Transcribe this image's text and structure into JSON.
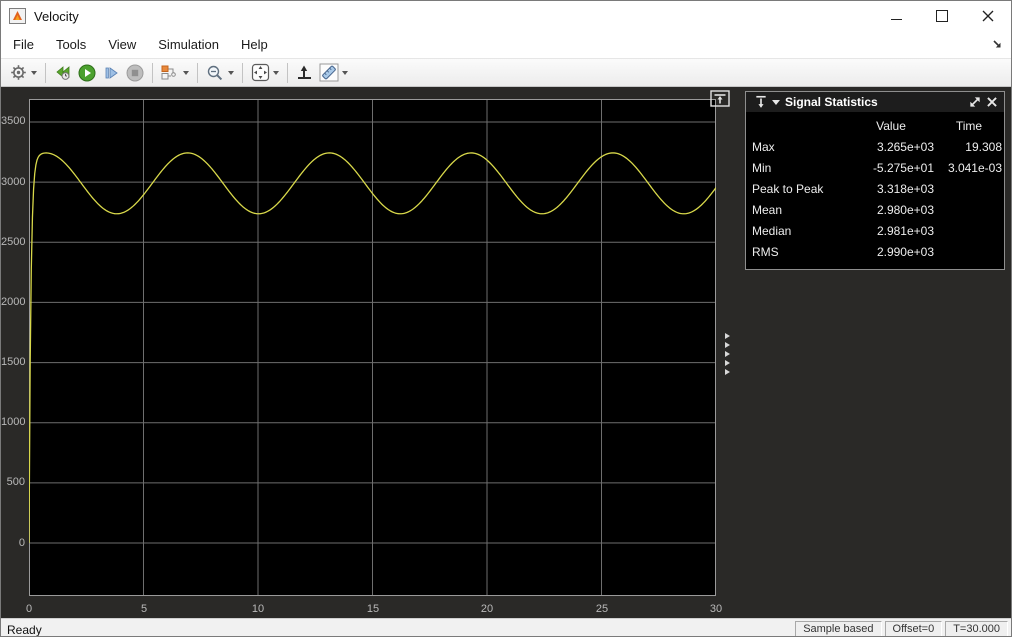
{
  "window": {
    "title": "Velocity"
  },
  "menu": {
    "items": [
      "File",
      "Tools",
      "View",
      "Simulation",
      "Help"
    ]
  },
  "toolbar": {
    "buttons": [
      {
        "name": "settings-gear-button",
        "dropdown": true
      },
      {
        "name": "step-back-button"
      },
      {
        "name": "run-button"
      },
      {
        "name": "step-forward-button"
      },
      {
        "name": "stop-button"
      },
      {
        "name": "signal-selector-button",
        "dropdown": true
      },
      {
        "name": "zoom-out-button",
        "dropdown": true
      },
      {
        "name": "fit-to-view-button",
        "dropdown": true
      },
      {
        "name": "trigger-button"
      },
      {
        "name": "measurements-button",
        "dropdown": true
      }
    ]
  },
  "stats_panel": {
    "title": "Signal Statistics",
    "columns": [
      "Value",
      "Time"
    ],
    "rows": [
      {
        "label": "Max",
        "value": "3.265e+03",
        "time": "19.308"
      },
      {
        "label": "Min",
        "value": "-5.275e+01",
        "time": "3.041e-03"
      },
      {
        "label": "Peak to Peak",
        "value": "3.318e+03",
        "time": ""
      },
      {
        "label": "Mean",
        "value": "2.980e+03",
        "time": ""
      },
      {
        "label": "Median",
        "value": "2.981e+03",
        "time": ""
      },
      {
        "label": "RMS",
        "value": "2.990e+03",
        "time": ""
      }
    ]
  },
  "statusbar": {
    "left": "Ready",
    "cells": [
      "Sample based",
      "Offset=0",
      "T=30.000"
    ]
  },
  "chart_data": {
    "type": "line",
    "title": "",
    "xlabel": "",
    "ylabel": "",
    "xlim": [
      0,
      30
    ],
    "ylim": [
      -443,
      3692
    ],
    "x_ticks": [
      0,
      5,
      10,
      15,
      20,
      25,
      30
    ],
    "y_ticks": [
      0,
      500,
      1000,
      1500,
      2000,
      2500,
      3000,
      3500
    ],
    "grid": true,
    "background": "#000000",
    "grid_color": "#6e6e6e",
    "axes_border_color": "#9a9a9a",
    "series": [
      {
        "name": "Velocity",
        "color": "#d8d84a",
        "x": [
          0,
          1,
          2,
          3,
          4,
          5,
          6,
          7,
          8,
          9,
          10,
          11,
          12,
          13,
          14,
          15,
          16,
          17,
          18,
          19,
          20,
          21,
          22,
          23,
          24,
          25,
          26,
          27,
          28,
          29,
          30
        ],
        "values": [
          0,
          3234,
          3062,
          2822,
          2741,
          2894,
          3138,
          3242,
          3107,
          2861,
          2737,
          2851,
          3096,
          3241,
          3147,
          2905,
          2743,
          2816,
          3051,
          3231,
          3183,
          2953,
          2758,
          2782,
          3002,
          3211,
          3211,
          3002,
          2781,
          2758,
          2955
        ]
      }
    ],
    "model": {
      "description": "fast first-order rise then steady sinusoid",
      "mean": 2990,
      "amplitude": 253,
      "period_s": 6.19,
      "peak_time_s": 19.308,
      "rise_tau_s": 0.08
    }
  }
}
